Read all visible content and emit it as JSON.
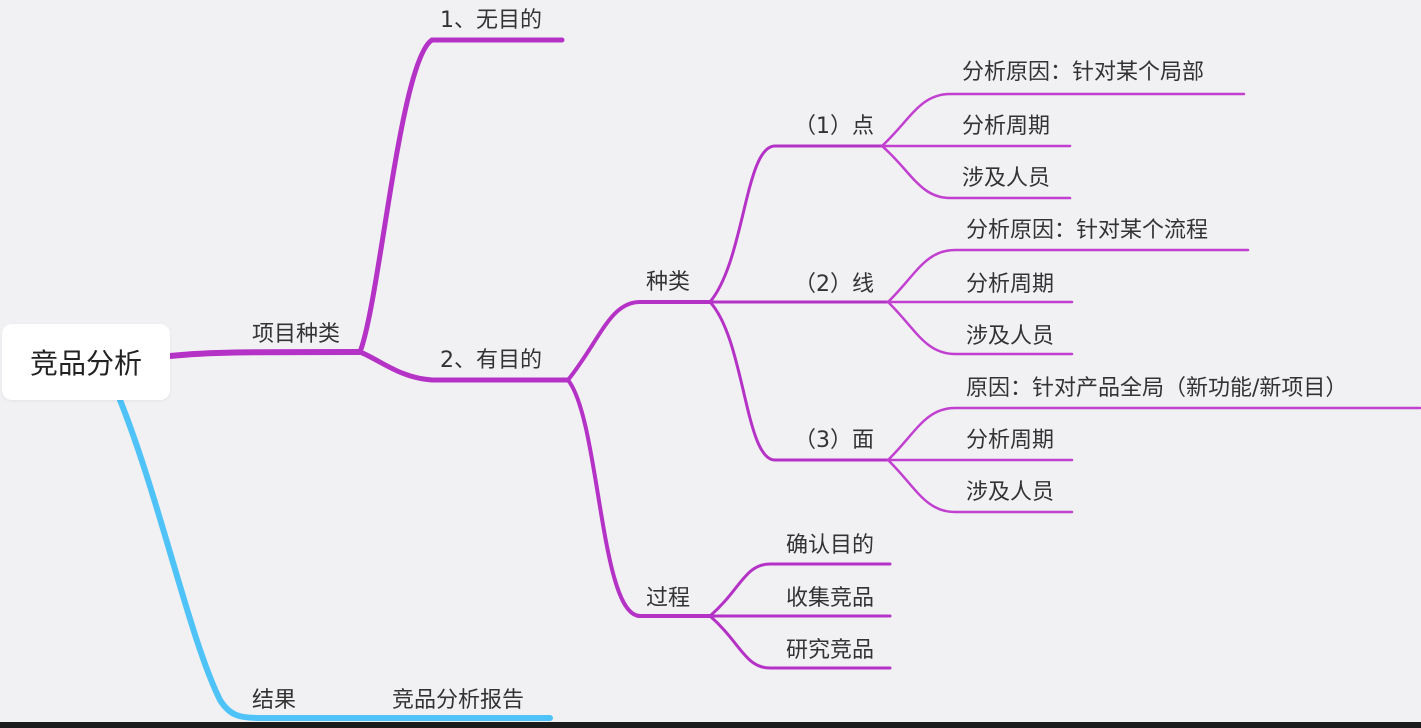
{
  "colors": {
    "purple": "#b532c6",
    "purple_light": "#c140d0",
    "blue": "#4fc3f7",
    "background": "#f1f1f4"
  },
  "root": "竞品分析",
  "branch_project_types": {
    "label": "项目种类",
    "no_purpose": "1、无目的",
    "with_purpose": {
      "label": "2、有目的",
      "types": {
        "label": "种类",
        "point": {
          "label": "（1）点",
          "reason": "分析原因：针对某个局部",
          "period": "分析周期",
          "people": "涉及人员"
        },
        "line": {
          "label": "（2）线",
          "reason": "分析原因：针对某个流程",
          "period": "分析周期",
          "people": "涉及人员"
        },
        "surface": {
          "label": "（3）面",
          "reason": "原因：针对产品全局（新功能/新项目）",
          "period": "分析周期",
          "people": "涉及人员"
        }
      },
      "process": {
        "label": "过程",
        "steps": [
          "确认目的",
          "收集竞品",
          "研究竞品"
        ]
      }
    }
  },
  "branch_result": {
    "label": "结果",
    "output": "竞品分析报告"
  }
}
